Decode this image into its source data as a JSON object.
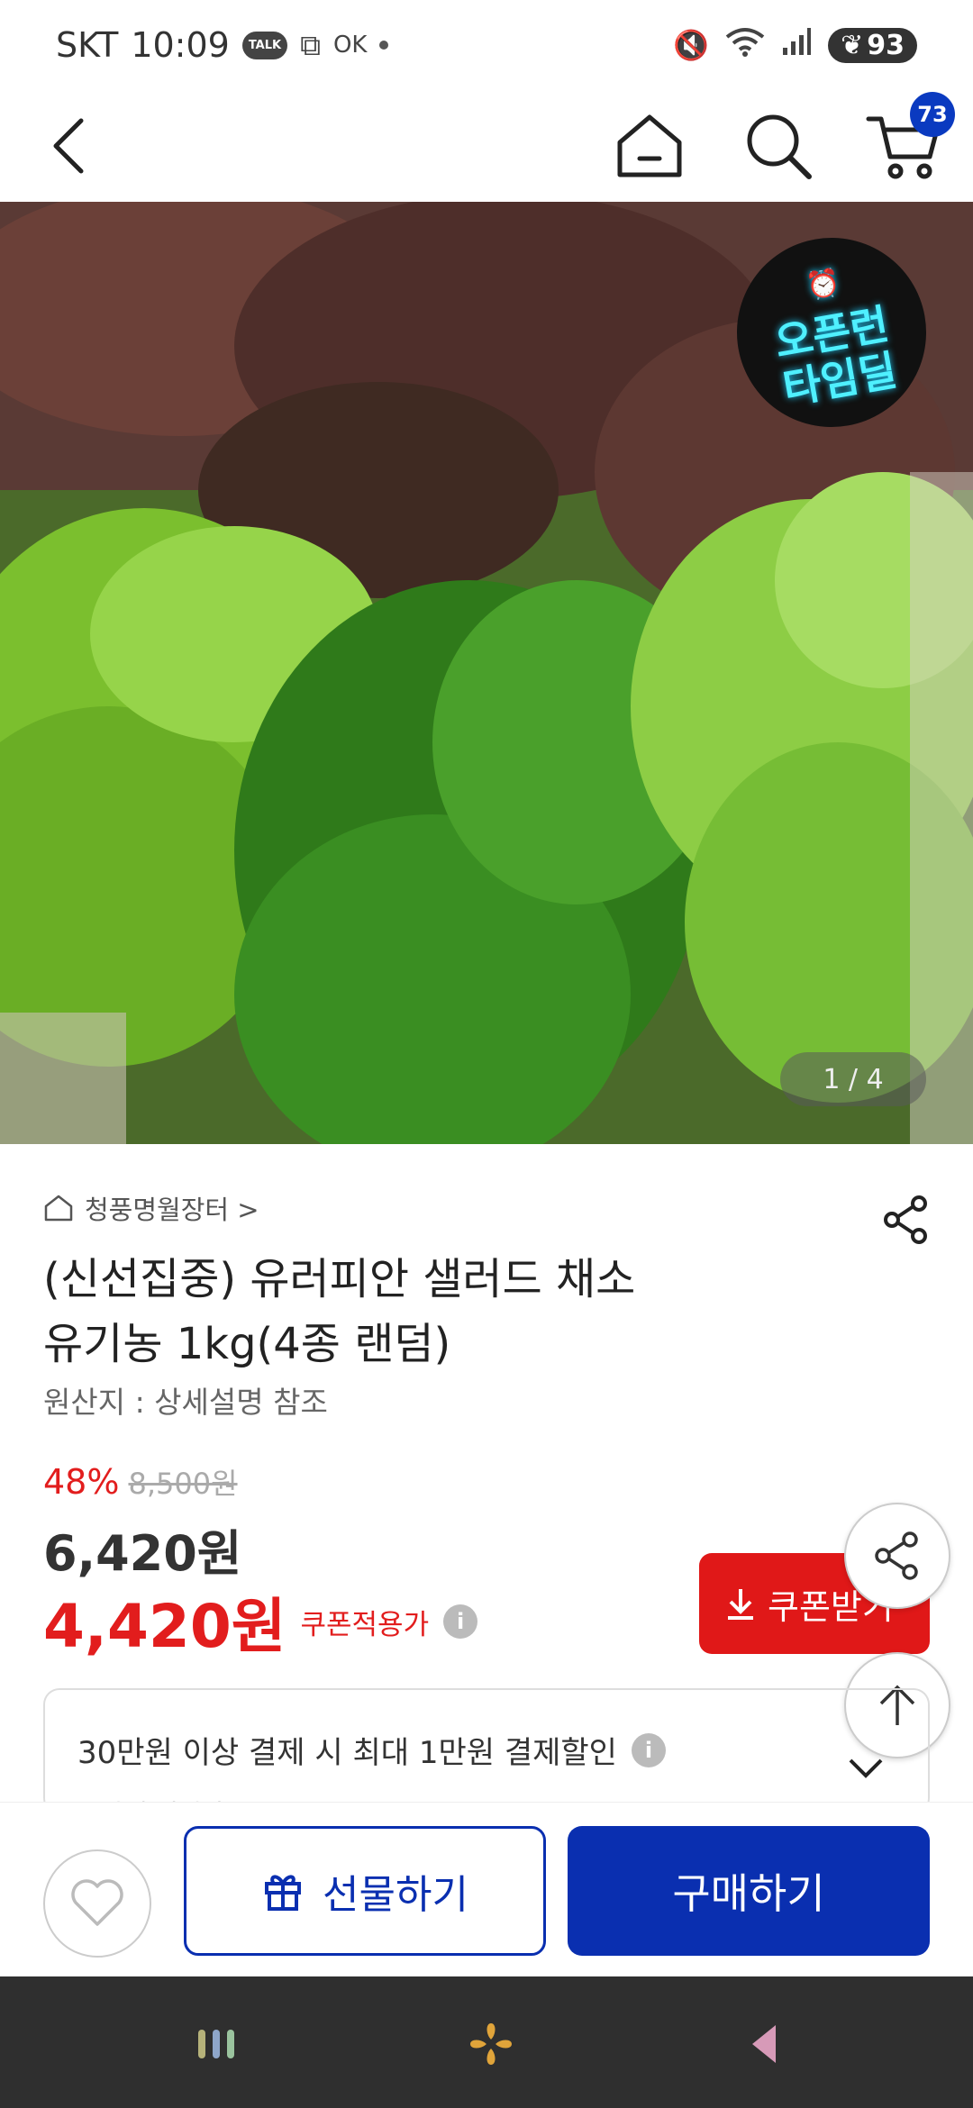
{
  "status_bar": {
    "carrier": "SKT",
    "time": "10:09",
    "talk_badge": "TALK",
    "ok_label": "OK",
    "battery": "93"
  },
  "header": {
    "cart_count": "73"
  },
  "hero": {
    "badge_line1": "오픈런",
    "badge_line2": "타임딜",
    "image_counter": "1 / 4"
  },
  "product": {
    "store_name": "청풍명월장터 >",
    "title_line1": "(신선집중) 유러피안 샐러드 채소",
    "title_line2": "유기농 1kg(4종 랜덤)",
    "origin": "원산지 : 상세설명 참조",
    "discount_rate": "48%",
    "original_price": "8,500원",
    "price": "6,420원",
    "coupon_price": "4,420원",
    "coupon_label": "쿠폰적용가",
    "coupon_button": "쿠폰받기"
  },
  "promo": {
    "text": "30만원 이상 결제 시 최대 1만원 결제할인",
    "subtext": "오마레 신선카드"
  },
  "actions": {
    "gift": "선물하기",
    "buy": "구매하기"
  },
  "colors": {
    "accent_blue": "#0a2fb0",
    "sale_red": "#e21d1d"
  }
}
